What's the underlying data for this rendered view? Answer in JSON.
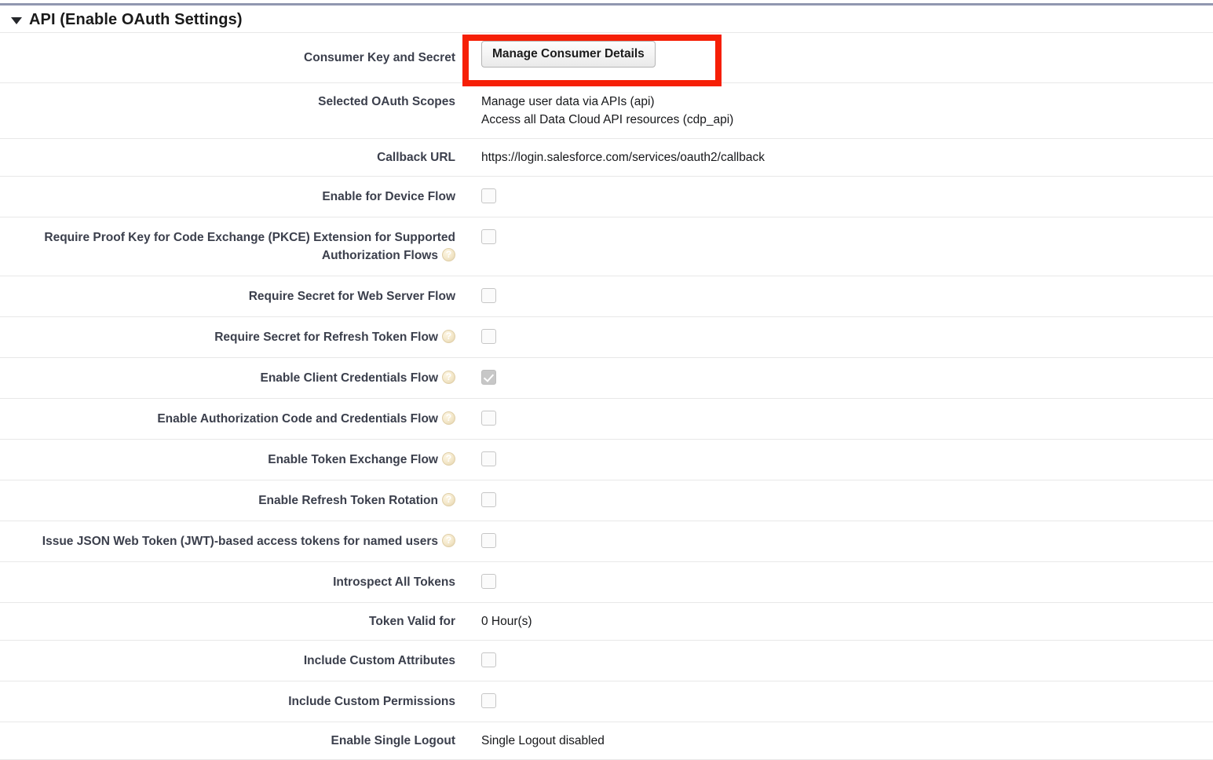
{
  "section": {
    "title": "API (Enable OAuth Settings)",
    "twisty_icon": "triangle-down-icon",
    "expanded": true
  },
  "highlight": {
    "color": "#f61f06",
    "target": "manage-consumer-details-button"
  },
  "rows": [
    {
      "label": "Consumer Key and Secret",
      "type": "button",
      "button_label": "Manage Consumer Details",
      "help": false
    },
    {
      "label": "Selected OAuth Scopes",
      "type": "text-multiline",
      "lines": [
        "Manage user data via APIs (api)",
        "Access all Data Cloud API resources (cdp_api)"
      ],
      "help": false
    },
    {
      "label": "Callback URL",
      "type": "text",
      "value": "https://login.salesforce.com/services/oauth2/callback",
      "help": false
    },
    {
      "label": "Enable for Device Flow",
      "type": "checkbox",
      "checked": false,
      "help": false
    },
    {
      "label": "Require Proof Key for Code Exchange (PKCE) Extension for Supported Authorization Flows",
      "type": "checkbox",
      "checked": false,
      "help": true
    },
    {
      "label": "Require Secret for Web Server Flow",
      "type": "checkbox",
      "checked": false,
      "help": false
    },
    {
      "label": "Require Secret for Refresh Token Flow",
      "type": "checkbox",
      "checked": false,
      "help": true
    },
    {
      "label": "Enable Client Credentials Flow",
      "type": "checkbox",
      "checked": true,
      "help": true
    },
    {
      "label": "Enable Authorization Code and Credentials Flow",
      "type": "checkbox",
      "checked": false,
      "help": true
    },
    {
      "label": "Enable Token Exchange Flow",
      "type": "checkbox",
      "checked": false,
      "help": true
    },
    {
      "label": "Enable Refresh Token Rotation",
      "type": "checkbox",
      "checked": false,
      "help": true
    },
    {
      "label": "Issue JSON Web Token (JWT)-based access tokens for named users",
      "type": "checkbox",
      "checked": false,
      "help": true
    },
    {
      "label": "Introspect All Tokens",
      "type": "checkbox",
      "checked": false,
      "help": false
    },
    {
      "label": "Token Valid for",
      "type": "text",
      "value": "0 Hour(s)",
      "help": false
    },
    {
      "label": "Include Custom Attributes",
      "type": "checkbox",
      "checked": false,
      "help": false
    },
    {
      "label": "Include Custom Permissions",
      "type": "checkbox",
      "checked": false,
      "help": false
    },
    {
      "label": "Enable Single Logout",
      "type": "text",
      "value": "Single Logout disabled",
      "help": false
    }
  ]
}
